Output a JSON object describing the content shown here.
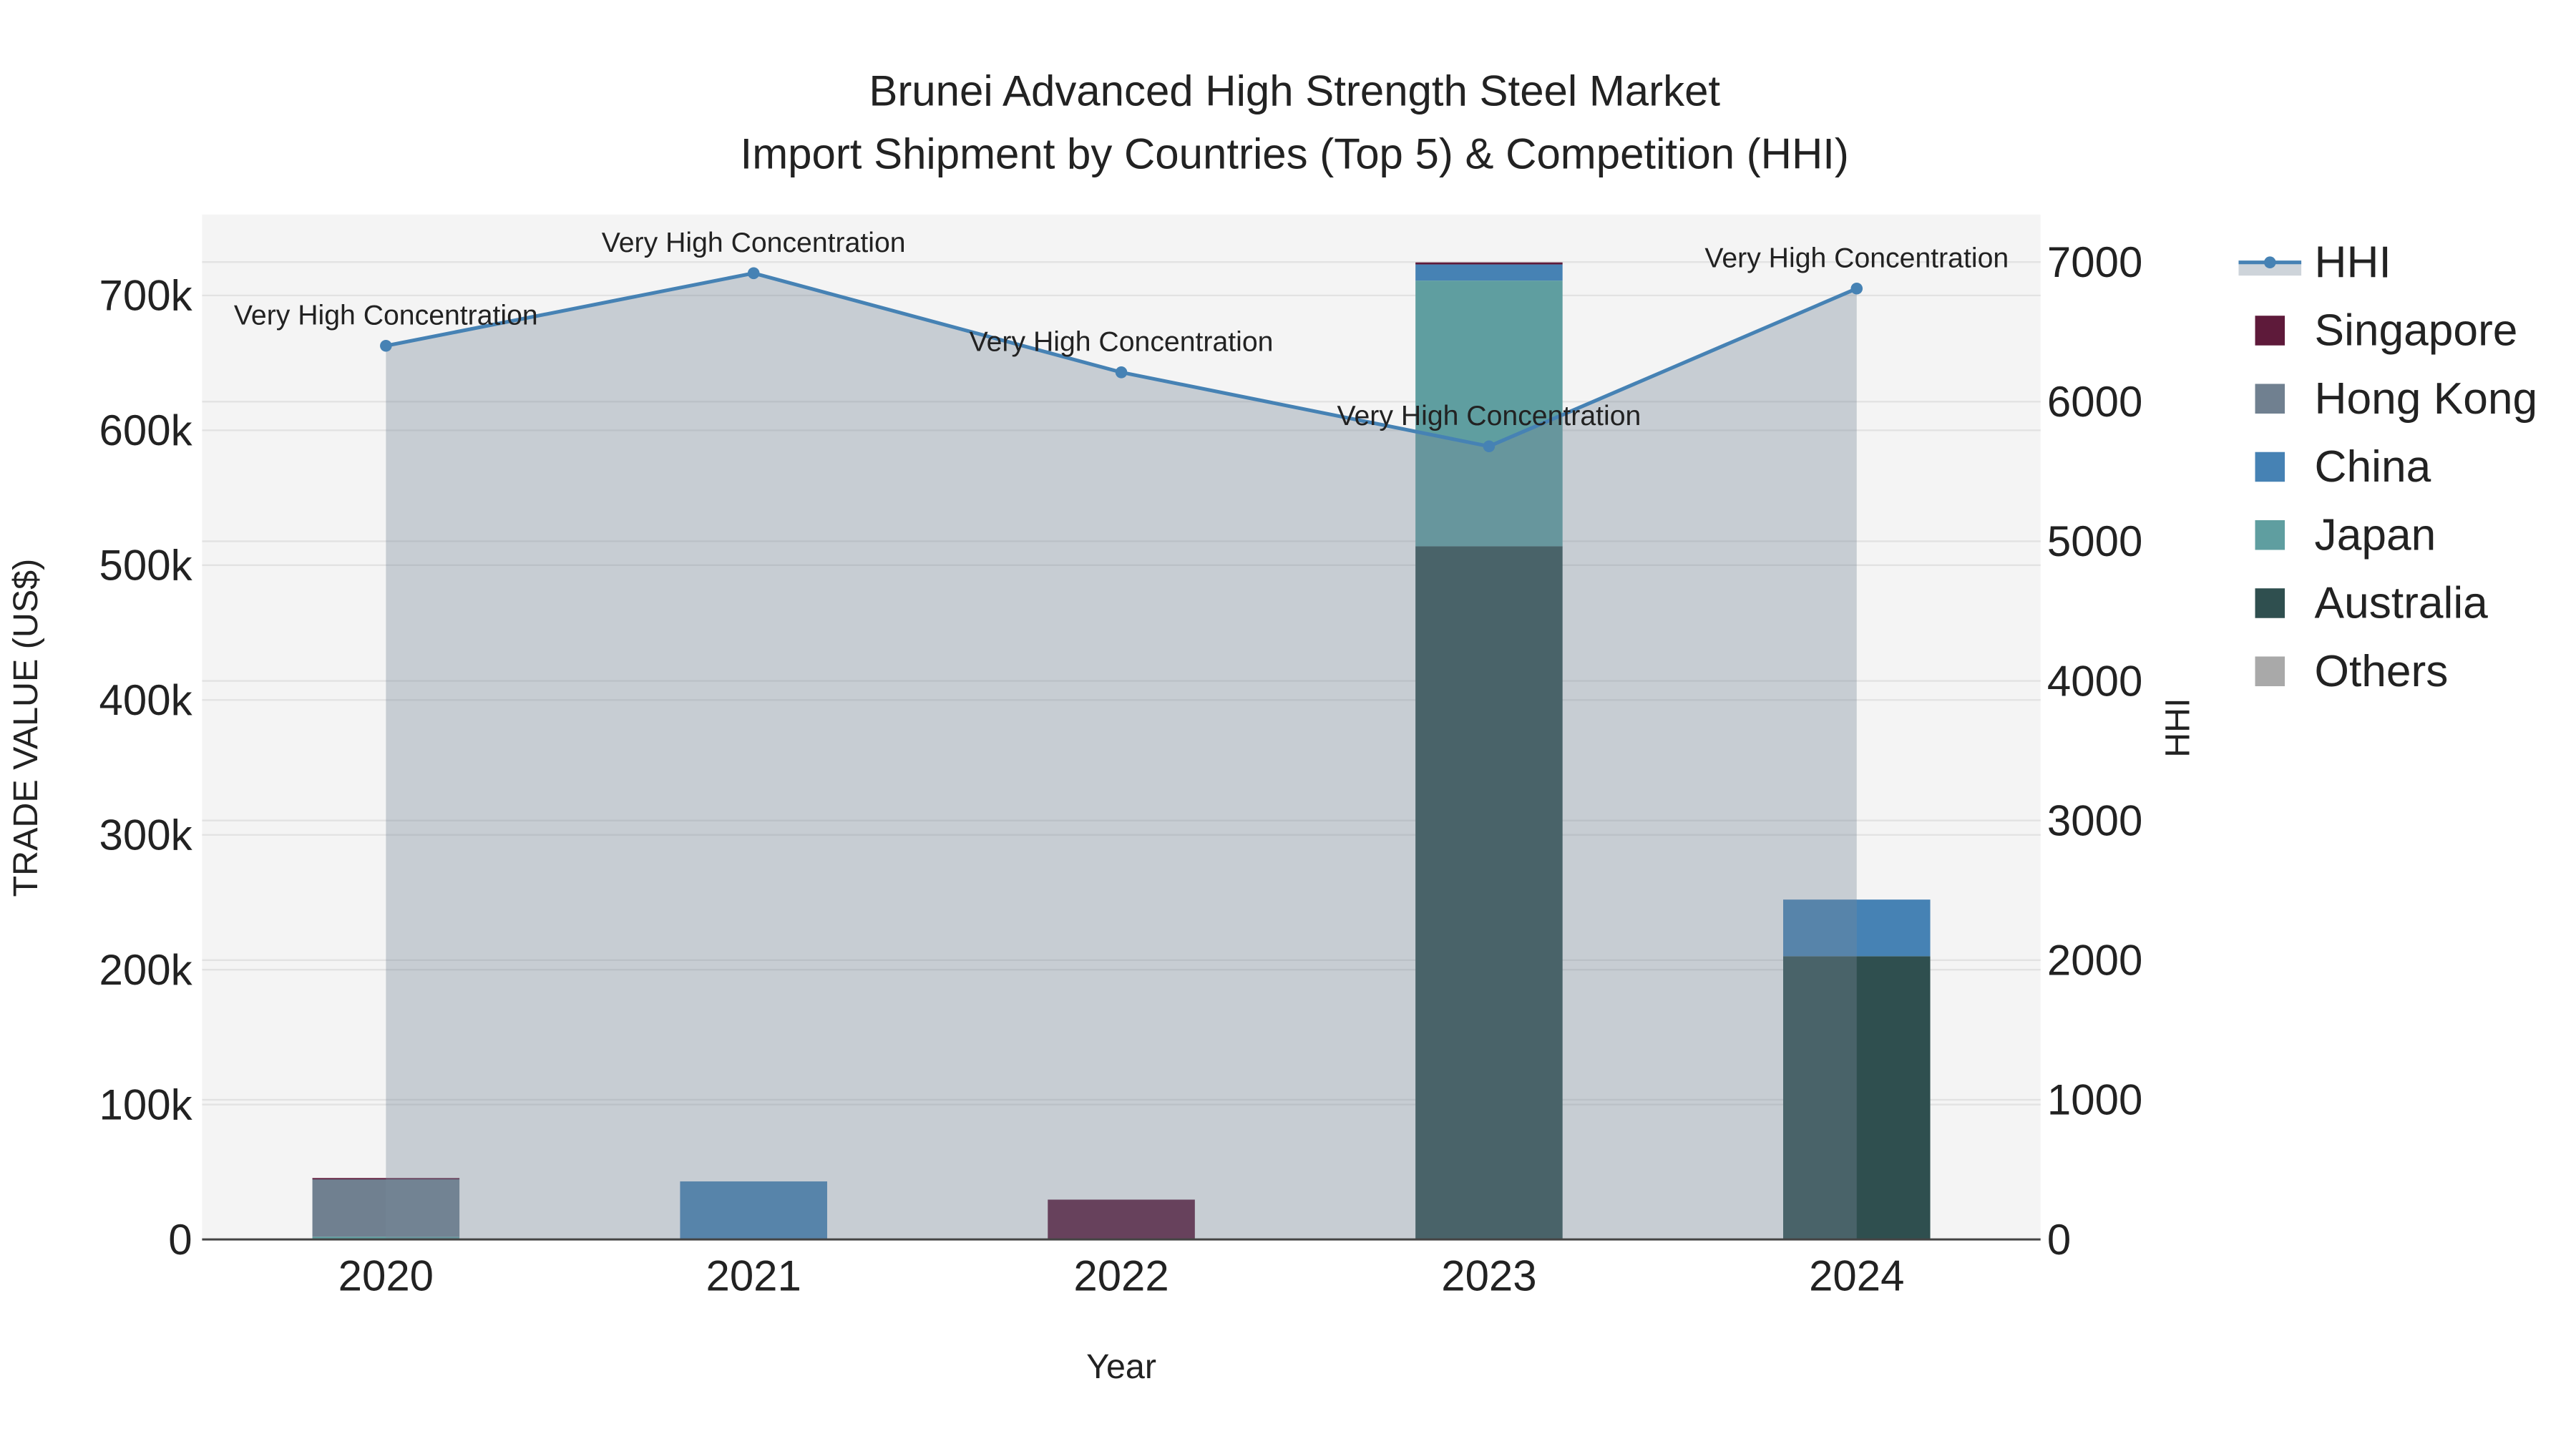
{
  "chart_data": {
    "type": "bar",
    "title": "Brunei Advanced High Strength Steel Market",
    "subtitle": "Import Shipment by Countries (Top 5) & Competition (HHI)",
    "xlabel": "Year",
    "ylabel": "TRADE VALUE (US$)",
    "y2label": "HHI",
    "categories": [
      "2020",
      "2021",
      "2022",
      "2023",
      "2024"
    ],
    "ylim": [
      0,
      760000
    ],
    "y_ticks": [
      0,
      100000,
      200000,
      300000,
      400000,
      500000,
      600000,
      700000
    ],
    "y_tick_labels": [
      "0",
      "100k",
      "200k",
      "300k",
      "400k",
      "500k",
      "600k",
      "700k"
    ],
    "y2lim": [
      0,
      7340
    ],
    "y2_ticks": [
      0,
      1000,
      2000,
      3000,
      4000,
      5000,
      6000,
      7000
    ],
    "y2_tick_labels": [
      "0",
      "1000",
      "2000",
      "3000",
      "4000",
      "5000",
      "6000",
      "7000"
    ],
    "grid": true,
    "legend_position": "right",
    "stack_order": [
      "Australia",
      "Japan",
      "China",
      "Hong Kong",
      "Singapore",
      "Others"
    ],
    "series": [
      {
        "name": "Singapore",
        "color": "#5e1a3a",
        "values": [
          500,
          0,
          29500,
          1500,
          0
        ]
      },
      {
        "name": "Hong Kong",
        "color": "#708090",
        "values": [
          43000,
          0,
          0,
          0,
          0
        ]
      },
      {
        "name": "China",
        "color": "#4682b4",
        "values": [
          0,
          43000,
          0,
          12000,
          42000
        ]
      },
      {
        "name": "Japan",
        "color": "#5f9ea0",
        "values": [
          2000,
          0,
          0,
          197000,
          0
        ]
      },
      {
        "name": "Australia",
        "color": "#2f4f4f",
        "values": [
          0,
          0,
          0,
          514000,
          210000
        ]
      },
      {
        "name": "Others",
        "color": "#a9a9a9",
        "values": [
          0,
          0,
          0,
          0,
          0
        ]
      }
    ],
    "hhi": {
      "name": "HHI",
      "color": "#4682b4",
      "values": [
        6400,
        6920,
        6210,
        5680,
        6810
      ],
      "annotations": [
        "Very High Concentration",
        "Very High Concentration",
        "Very High Concentration",
        "Very High Concentration",
        "Very High Concentration"
      ]
    }
  }
}
